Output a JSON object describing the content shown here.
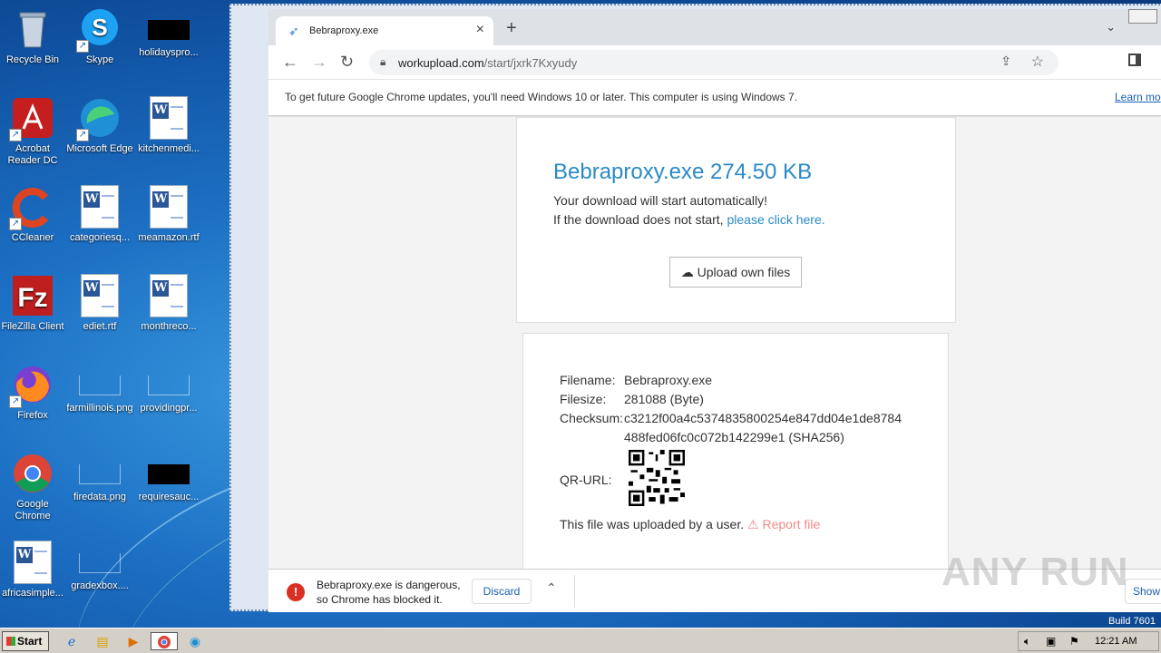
{
  "desktop": {
    "icons": [
      {
        "label": "Recycle Bin",
        "icon": "recycle-bin-icon"
      },
      {
        "label": "Skype",
        "icon": "skype-icon"
      },
      {
        "label": "holidayspro...",
        "icon": "black-thumbnail-icon"
      },
      {
        "label": "Acrobat Reader DC",
        "icon": "acrobat-icon"
      },
      {
        "label": "Microsoft Edge",
        "icon": "edge-icon"
      },
      {
        "label": "kitchenmedi...",
        "icon": "word-doc-icon"
      },
      {
        "label": "CCleaner",
        "icon": "ccleaner-icon"
      },
      {
        "label": "categoriesq...",
        "icon": "word-doc-icon"
      },
      {
        "label": "meamazon.rtf",
        "icon": "word-doc-icon"
      },
      {
        "label": "FileZilla Client",
        "icon": "filezilla-icon"
      },
      {
        "label": "ediet.rtf",
        "icon": "word-doc-icon"
      },
      {
        "label": "monthreco...",
        "icon": "word-doc-icon"
      },
      {
        "label": "Firefox",
        "icon": "firefox-icon"
      },
      {
        "label": "farmillinois.png",
        "icon": "blank-image-icon"
      },
      {
        "label": "providingpr...",
        "icon": "blank-image-icon"
      },
      {
        "label": "Google Chrome",
        "icon": "chrome-icon"
      },
      {
        "label": "firedata.png",
        "icon": "blank-image-icon"
      },
      {
        "label": "requiresauc...",
        "icon": "black-thumbnail-icon"
      },
      {
        "label": "africasimple...",
        "icon": "word-doc-icon"
      },
      {
        "label": "gradexbox....",
        "icon": "blank-image-icon"
      }
    ]
  },
  "browser": {
    "tab_title": "Bebraproxy.exe",
    "url_host": "workupload.com",
    "url_path": "/start/jxrk7Kxyudy",
    "infobar_message": "To get future Google Chrome updates, you'll need Windows 10 or later. This computer is using Windows 7.",
    "infobar_link": "Learn mo"
  },
  "page": {
    "heading": "Bebraproxy.exe 274.50 KB",
    "auto_msg": "Your download will start automatically!",
    "fallback_msg": "If the download does not start, ",
    "fallback_link": "please click here.",
    "upload_button": "Upload own files",
    "details": {
      "filename_label": "Filename:",
      "filename": "Bebraproxy.exe",
      "filesize_label": "Filesize:",
      "filesize": "281088 (Byte)",
      "checksum_label": "Checksum:",
      "checksum_line1": "c3212f00a4c5374835800254e847dd04e1de8784",
      "checksum_line2": "488fed06fc0c072b142299e1 (SHA256)",
      "qr_label": "QR-URL:",
      "uploaded_by": "This file was uploaded by a user.",
      "report": "Report file"
    }
  },
  "download_bar": {
    "line1": "Bebraproxy.exe is dangerous,",
    "line2": "so Chrome has blocked it.",
    "discard": "Discard",
    "show_all": "Show a"
  },
  "overlay": {
    "watermark": "ANY RUN",
    "build": "Build 7601"
  },
  "taskbar": {
    "start": "Start",
    "clock": "12:21 AM"
  }
}
